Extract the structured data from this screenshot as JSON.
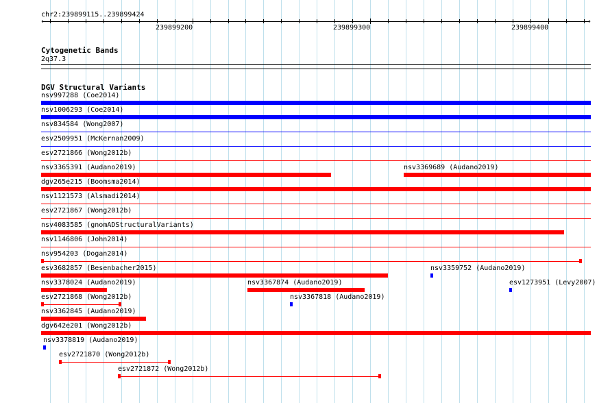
{
  "region": {
    "label": "chr2:239899115..239899424",
    "start": 239899115,
    "end": 239899424,
    "positions": [
      "239899200",
      "239899300",
      "239899400"
    ]
  },
  "cytobands": {
    "title": "Cytogenetic Bands",
    "band": "2q37.3"
  },
  "dgv": {
    "title": "DGV Structural Variants",
    "colors": {
      "loss": "#ff0000",
      "gain": "#0000ff"
    },
    "features": [
      {
        "label": "nsv997288 (Coe2014)",
        "start": 239899115,
        "end": 239899424,
        "color": "blue",
        "style": "thick",
        "row": 0
      },
      {
        "label": "nsv1006293 (Coe2014)",
        "start": 239899115,
        "end": 239899424,
        "color": "blue",
        "style": "thick",
        "row": 1
      },
      {
        "label": "nsv834584 (Wong2007)",
        "start": 239899115,
        "end": 239899424,
        "color": "blue",
        "style": "line",
        "row": 2
      },
      {
        "label": "esv2509951 (McKernan2009)",
        "start": 239899115,
        "end": 239899424,
        "color": "blue",
        "style": "line",
        "row": 3
      },
      {
        "label": "esv2721866 (Wong2012b)",
        "start": 239899115,
        "end": 239899424,
        "color": "red",
        "style": "line",
        "row": 4
      },
      {
        "label": "nsv3365391 (Audano2019)",
        "start": 239899115,
        "end": 239899278,
        "color": "red",
        "style": "thick",
        "row": 5
      },
      {
        "label": "nsv3369689 (Audano2019)",
        "start": 239899319,
        "end": 239899424,
        "color": "red",
        "style": "thick",
        "row": 5
      },
      {
        "label": "dgv265e215 (Boomsma2014)",
        "start": 239899115,
        "end": 239899424,
        "color": "red",
        "style": "thick",
        "row": 6
      },
      {
        "label": "nsv1121573 (Alsmadi2014)",
        "start": 239899115,
        "end": 239899424,
        "color": "red",
        "style": "line",
        "row": 7
      },
      {
        "label": "esv2721867 (Wong2012b)",
        "start": 239899115,
        "end": 239899424,
        "color": "red",
        "style": "line",
        "row": 8
      },
      {
        "label": "nsv4083585 (gnomADStructuralVariants)",
        "start": 239899115,
        "end": 239899409,
        "color": "red",
        "style": "thick",
        "row": 9
      },
      {
        "label": "nsv1146806 (John2014)",
        "start": 239899115,
        "end": 239899424,
        "color": "red",
        "style": "line",
        "row": 10
      },
      {
        "label": "nsv954203 (Dogan2014)",
        "start": 239899115,
        "end": 239899419,
        "color": "red",
        "style": "capline",
        "row": 11
      },
      {
        "label": "esv3682857 (Besenbacher2015)",
        "start": 239899115,
        "end": 239899310,
        "color": "red",
        "style": "thick",
        "row": 12
      },
      {
        "label": "nsv3359752 (Audano2019)",
        "start": 239899334,
        "end": 239899335,
        "color": "blue",
        "style": "dot",
        "row": 12
      },
      {
        "label": "nsv3378024 (Audano2019)",
        "start": 239899115,
        "end": 239899152,
        "color": "red",
        "style": "thick",
        "row": 13
      },
      {
        "label": "nsv3367874 (Audano2019)",
        "start": 239899231,
        "end": 239899297,
        "color": "red",
        "style": "thick",
        "row": 13
      },
      {
        "label": "esv1273951 (Levy2007)",
        "start": 239899378,
        "end": 239899379,
        "color": "blue",
        "style": "dot",
        "row": 13
      },
      {
        "label": "esv2721868 (Wong2012b)",
        "start": 239899115,
        "end": 239899160,
        "color": "red",
        "style": "capline",
        "row": 14
      },
      {
        "label": "nsv3367818 (Audano2019)",
        "start": 239899255,
        "end": 239899256,
        "color": "blue",
        "style": "dot",
        "row": 14
      },
      {
        "label": "nsv3362845 (Audano2019)",
        "start": 239899115,
        "end": 239899174,
        "color": "red",
        "style": "thick",
        "row": 15
      },
      {
        "label": "dgv642e201 (Wong2012b)",
        "start": 239899115,
        "end": 239899424,
        "color": "red",
        "style": "thick",
        "row": 16
      },
      {
        "label": "nsv3378819 (Audano2019)",
        "start": 239899116,
        "end": 239899117,
        "color": "blue",
        "style": "dot",
        "row": 17
      },
      {
        "label": "esv2721870 (Wong2012b)",
        "start": 239899125,
        "end": 239899188,
        "color": "red",
        "style": "capline",
        "row": 18
      },
      {
        "label": "esv2721872 (Wong2012b)",
        "start": 239899158,
        "end": 239899306,
        "color": "red",
        "style": "capline",
        "row": 19
      }
    ]
  }
}
